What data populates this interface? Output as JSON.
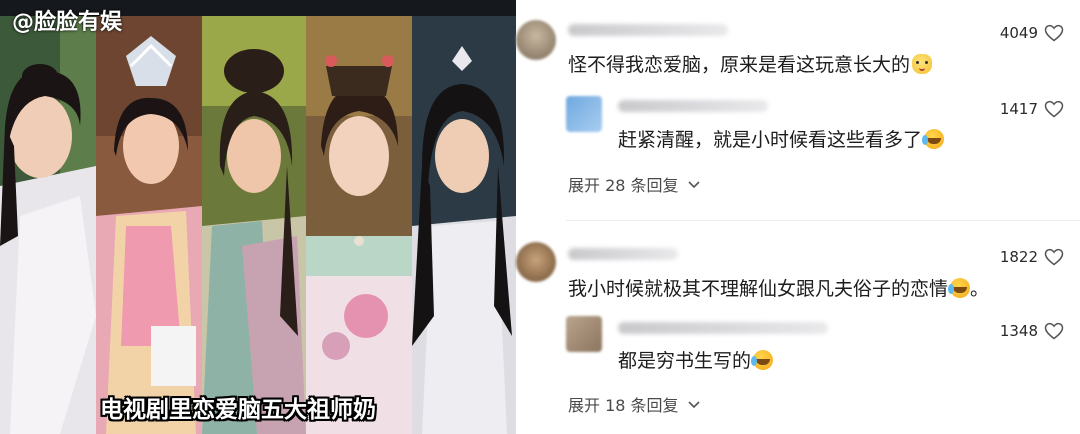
{
  "video": {
    "watermark": "@脸脸有娱",
    "caption": "电视剧里恋爱脑五大祖师奶"
  },
  "comments": [
    {
      "text": "怪不得我恋爱脑，原来是看这玩意长大的",
      "emoji": "cat-emoji",
      "likes": "4049",
      "replies": [
        {
          "text": "赶紧清醒，就是小时候看这些看多了",
          "emoji": "crying-laughing-emoji",
          "likes": "1417"
        }
      ],
      "expand_label": "展开 28 条回复"
    },
    {
      "text": "我小时候就极其不理解仙女跟凡夫俗子的恋情",
      "text_suffix": "。",
      "emoji": "crying-laughing-emoji",
      "likes": "1822",
      "replies": [
        {
          "text": "都是穷书生写的",
          "emoji": "crying-laughing-emoji",
          "likes": "1348"
        }
      ],
      "expand_label": "展开 18 条回复"
    }
  ],
  "icons": {
    "like": "heart-outline-icon",
    "expand": "chevron-down-icon"
  },
  "colors": {
    "text": "#1d1d1f",
    "secondary": "#4a4a4a",
    "divider": "#ededed",
    "caption": "#ffffff"
  }
}
